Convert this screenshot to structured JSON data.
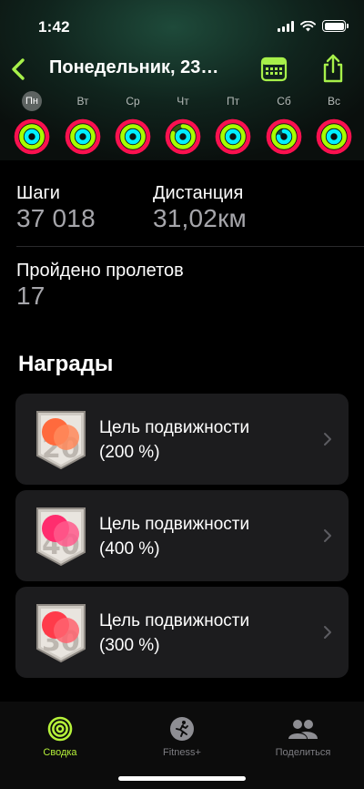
{
  "status_bar": {
    "time": "1:42"
  },
  "nav": {
    "title": "Понедельник, 23…",
    "accent_color": "#a7f04a"
  },
  "week": {
    "days": [
      {
        "label": "Пн",
        "selected": true,
        "move": 1.0,
        "exercise": 1.0,
        "stand": 1.0
      },
      {
        "label": "Вт",
        "selected": false,
        "move": 1.0,
        "exercise": 1.0,
        "stand": 1.0
      },
      {
        "label": "Ср",
        "selected": false,
        "move": 1.0,
        "exercise": 1.0,
        "stand": 1.0
      },
      {
        "label": "Чт",
        "selected": false,
        "move": 1.0,
        "exercise": 0.8,
        "stand": 1.0
      },
      {
        "label": "Пт",
        "selected": false,
        "move": 1.0,
        "exercise": 1.0,
        "stand": 1.0
      },
      {
        "label": "Сб",
        "selected": false,
        "move": 1.0,
        "exercise": 1.0,
        "stand": 0.75
      },
      {
        "label": "Вс",
        "selected": false,
        "move": 1.0,
        "exercise": 1.0,
        "stand": 1.0
      }
    ],
    "ring_colors": {
      "move": "#fa114f",
      "exercise": "#a6ff00",
      "stand": "#00f0ff"
    }
  },
  "stats": {
    "steps_label": "Шаги",
    "steps_value": "37 018",
    "distance_label": "Дистанция",
    "distance_value": "31,02км",
    "flights_label": "Пройдено пролетов",
    "flights_value": "17"
  },
  "awards": {
    "title": "Награды",
    "items": [
      {
        "line1": "Цель подвижности",
        "line2": "(200 %)",
        "badge_color": "#ff6a3d"
      },
      {
        "line1": "Цель подвижности",
        "line2": "(400 %)",
        "badge_color": "#ff2d6e"
      },
      {
        "line1": "Цель подвижности",
        "line2": "(300 %)",
        "badge_color": "#ff3b4a"
      }
    ]
  },
  "tab_bar": {
    "tabs": [
      {
        "label": "Сводка",
        "icon": "activity-rings-icon",
        "active": true
      },
      {
        "label": "Fitness+",
        "icon": "running-figure-icon",
        "active": false
      },
      {
        "label": "Поделиться",
        "icon": "people-icon",
        "active": false
      }
    ]
  }
}
